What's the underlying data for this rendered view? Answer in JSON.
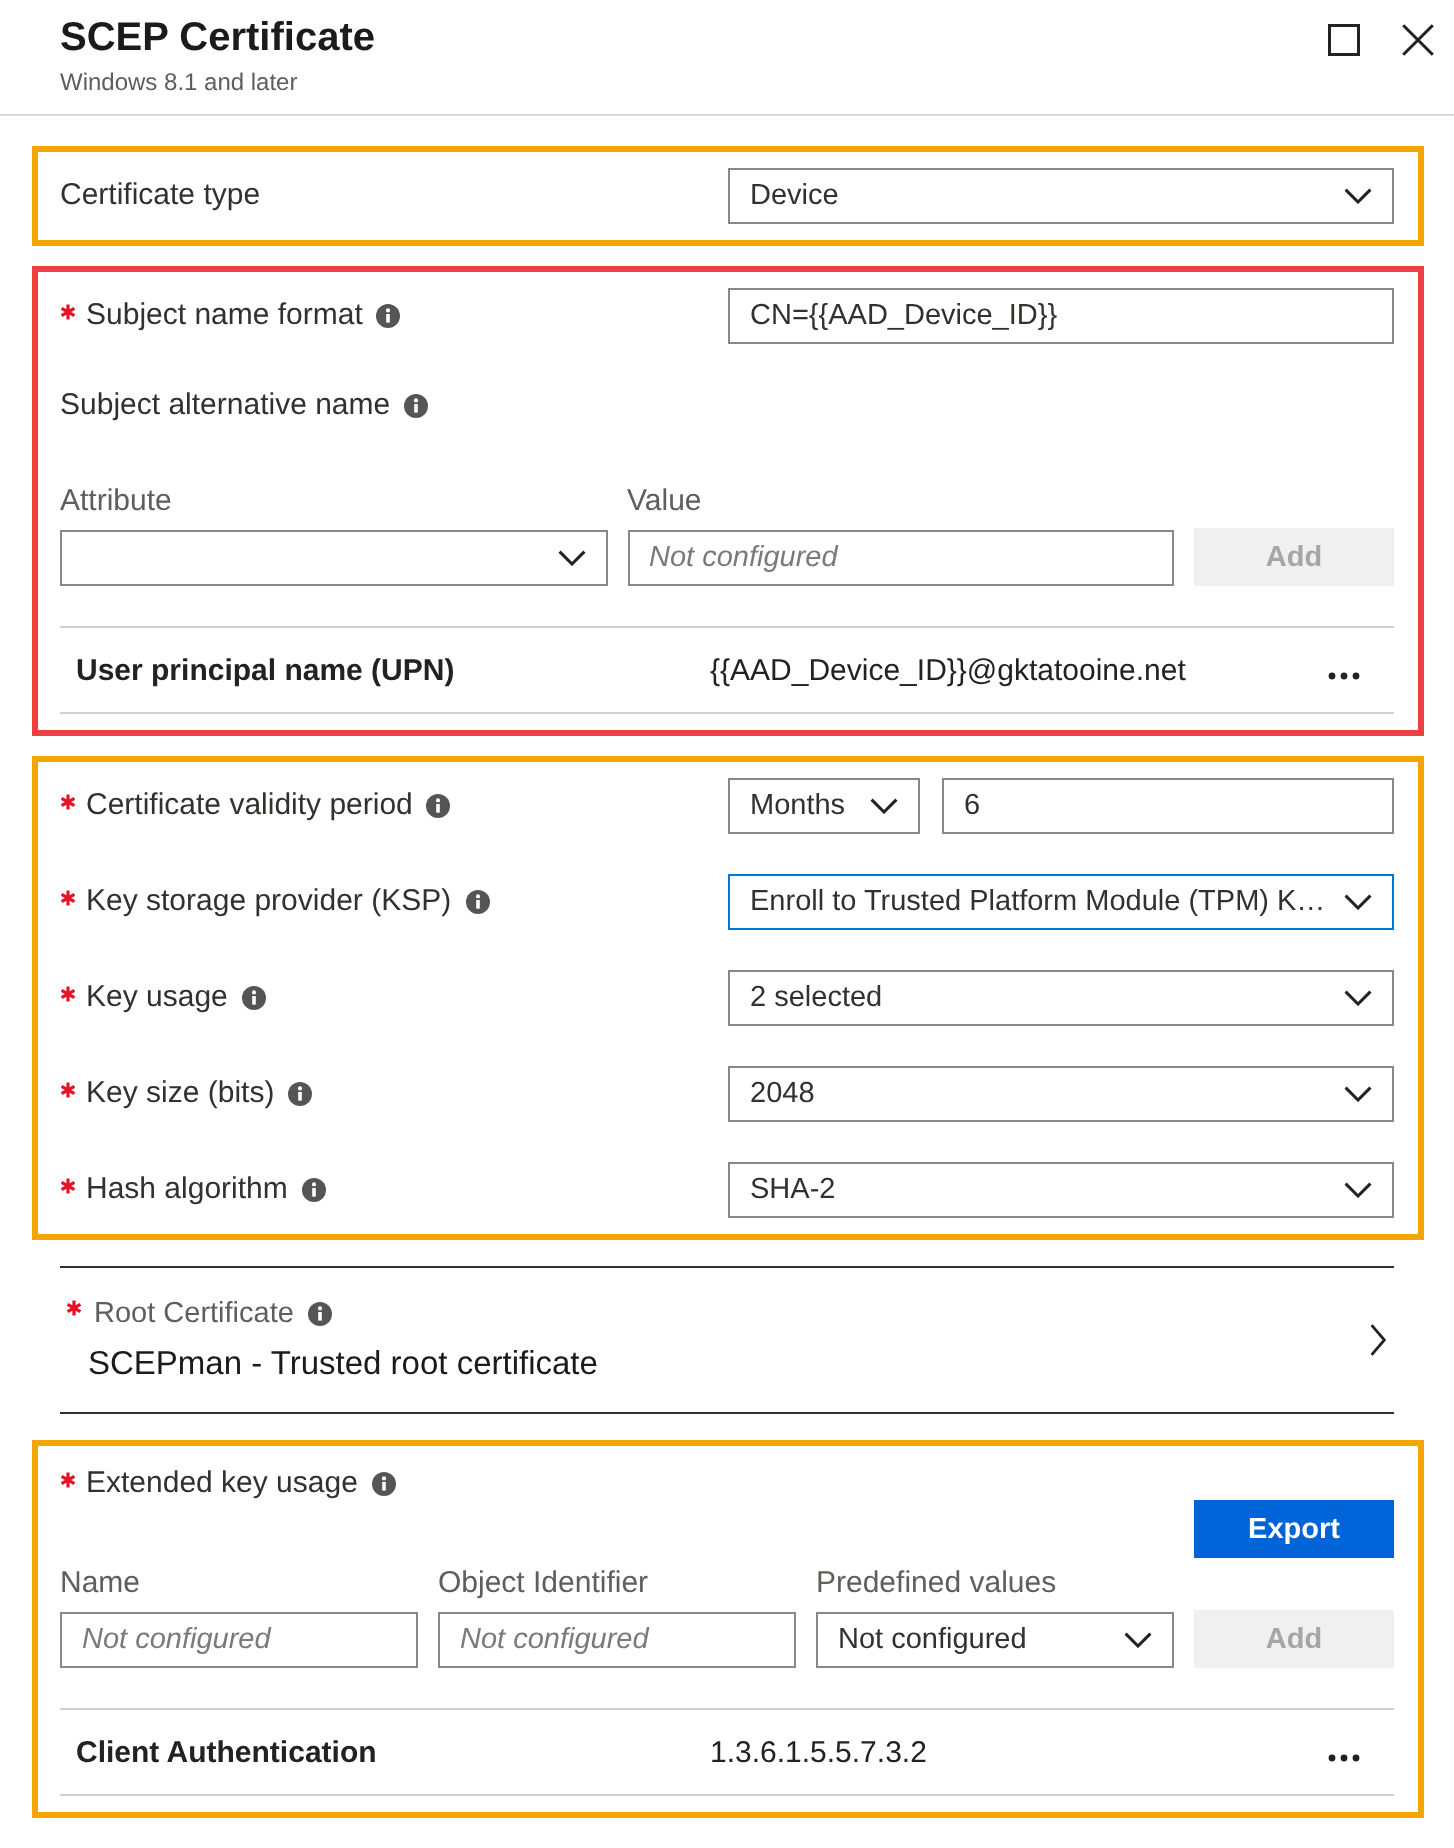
{
  "panel": {
    "title": "SCEP Certificate",
    "subtitle": "Windows 8.1 and later"
  },
  "sections": [
    {
      "color": "#f5a500",
      "items": [
        {
          "kind": "select",
          "label": "Certificate type",
          "required": false,
          "info": false,
          "value": "Device",
          "focused": false
        }
      ]
    },
    {
      "color": "#ef4040",
      "items": [
        {
          "kind": "text",
          "label": "Subject name format",
          "required": true,
          "info": true,
          "value": "CN={{AAD_Device_ID}}",
          "focused": false
        },
        {
          "kind": "heading",
          "label": "Subject alternative name",
          "required": false,
          "info": true
        },
        {
          "kind": "add-form",
          "fields": [
            {
              "kind": "select",
              "label": "Attribute"
            },
            {
              "kind": "input",
              "label": "Value",
              "placeholder": "Not configured"
            }
          ],
          "add_button": {
            "label": "Add",
            "disabled": true
          }
        },
        {
          "kind": "entries",
          "rows": [
            {
              "name": "User principal name (UPN)",
              "value": "{{AAD_Device_ID}}@gktatooine.net"
            }
          ]
        }
      ]
    },
    {
      "color": "#f5a500",
      "items": [
        {
          "kind": "period",
          "label": "Certificate validity period",
          "required": true,
          "info": true,
          "unit": "Months",
          "value": "6",
          "focused": false
        },
        {
          "kind": "select",
          "label": "Key storage provider (KSP)",
          "required": true,
          "info": true,
          "value": "Enroll to Trusted Platform Module (TPM) K…",
          "focused": true
        },
        {
          "kind": "select",
          "label": "Key usage",
          "required": true,
          "info": true,
          "value": "2 selected",
          "focused": false
        },
        {
          "kind": "select",
          "label": "Key size (bits)",
          "required": true,
          "info": true,
          "value": "2048",
          "focused": false
        },
        {
          "kind": "select",
          "label": "Hash algorithm",
          "required": true,
          "info": true,
          "value": "SHA-2",
          "focused": false
        }
      ]
    },
    {
      "items": [
        {
          "kind": "link",
          "label": "Root Certificate",
          "required": true,
          "info": true,
          "value": "SCEPman - Trusted root certificate"
        }
      ]
    },
    {
      "color": "#f5a500",
      "items": [
        {
          "kind": "heading",
          "label": "Extended key usage",
          "required": true,
          "info": true,
          "button": {
            "label": "Export",
            "disabled": false
          }
        },
        {
          "kind": "add-form",
          "fields": [
            {
              "kind": "input",
              "label": "Name",
              "placeholder": "Not configured"
            },
            {
              "kind": "input",
              "label": "Object Identifier",
              "placeholder": "Not configured"
            },
            {
              "kind": "select",
              "label": "Predefined values",
              "value": "Not configured"
            }
          ],
          "add_button": {
            "label": "Add",
            "disabled": true
          }
        },
        {
          "kind": "entries",
          "rows": [
            {
              "name": "Client Authentication",
              "value": "1.3.6.1.5.5.7.3.2"
            }
          ]
        }
      ]
    }
  ]
}
